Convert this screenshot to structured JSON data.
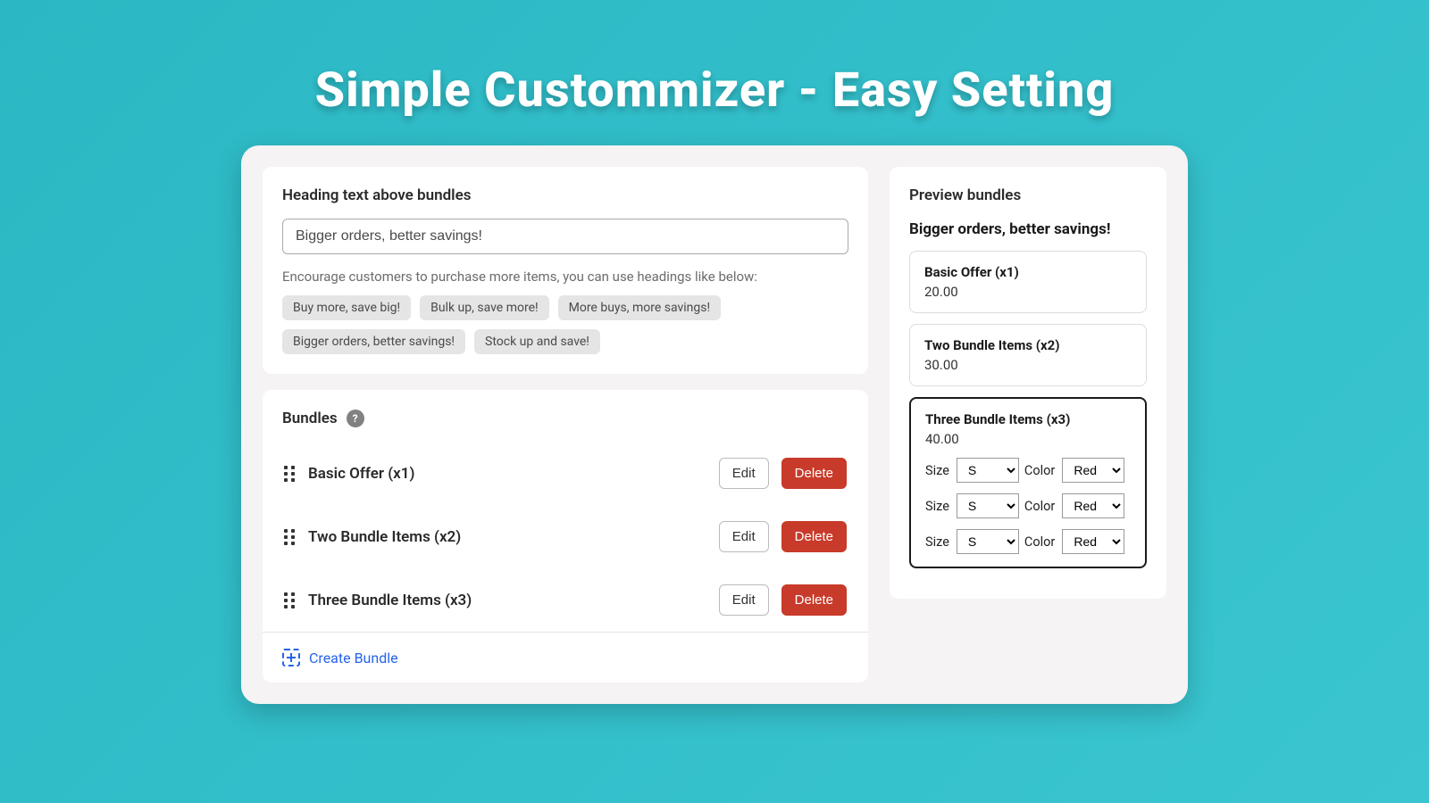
{
  "hero": {
    "title": "Simple Custommizer -  Easy Setting"
  },
  "heading_section": {
    "title": "Heading text above bundles",
    "input_value": "Bigger orders, better savings!",
    "hint": "Encourage customers to purchase more items, you can use headings like below:",
    "suggestions": [
      "Buy more, save big!",
      "Bulk up, save more!",
      "More buys, more savings!",
      "Bigger orders, better savings!",
      "Stock up and save!"
    ]
  },
  "bundles_section": {
    "title": "Bundles",
    "edit_label": "Edit",
    "delete_label": "Delete",
    "create_label": "Create Bundle",
    "items": [
      {
        "name": "Basic Offer (x1)"
      },
      {
        "name": "Two Bundle Items (x2)"
      },
      {
        "name": "Three Bundle Items (x3)"
      }
    ]
  },
  "preview": {
    "title": "Preview bundles",
    "heading": "Bigger orders, better savings!",
    "size_label": "Size",
    "color_label": "Color",
    "size_value": "S",
    "color_value": "Red",
    "bundles": [
      {
        "name": "Basic Offer (x1)",
        "price": "20.00"
      },
      {
        "name": "Two Bundle Items (x2)",
        "price": "30.00"
      },
      {
        "name": "Three Bundle Items (x3)",
        "price": "40.00"
      }
    ]
  }
}
